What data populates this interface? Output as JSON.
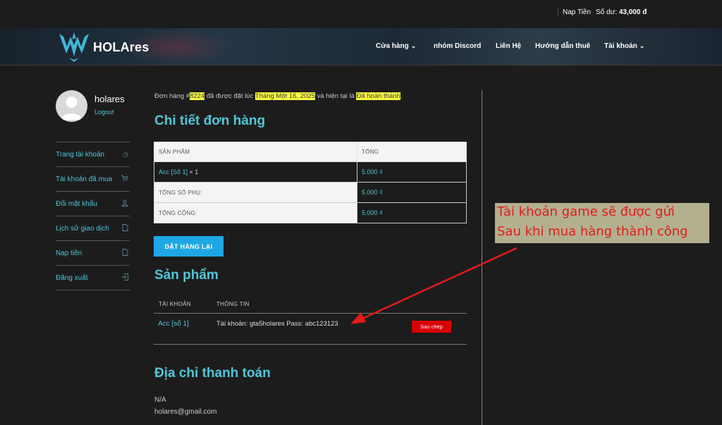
{
  "topbar": {
    "nap_tien": "Nap Tiền",
    "balance_label": "Số dư:",
    "balance_value": "43,000 đ"
  },
  "header": {
    "logo_text": "HOLAres",
    "nav": [
      {
        "label": "Cửa hàng",
        "has_dropdown": true
      },
      {
        "label": "nhóm Discord",
        "has_dropdown": false
      },
      {
        "label": "Liên Hệ",
        "has_dropdown": false
      },
      {
        "label": "Hướng dẫn thuê",
        "has_dropdown": false
      },
      {
        "label": "Tài khoản",
        "has_dropdown": true
      }
    ],
    "chevron": "⌄"
  },
  "sidebar": {
    "username": "holares",
    "logout": "Logout",
    "items": [
      {
        "label": "Trang tài khoản",
        "icon": "dashboard-icon",
        "glyph": "◷"
      },
      {
        "label": "Tài khoản đã mua",
        "icon": "cart-icon",
        "glyph": "🛒"
      },
      {
        "label": "Đổi mật khẩu",
        "icon": "user-icon",
        "glyph": "♙"
      },
      {
        "label": "Lịch sử giao dịch",
        "icon": "document-icon",
        "glyph": "▯"
      },
      {
        "label": "Nạp tiền",
        "icon": "document-icon",
        "glyph": "▯"
      },
      {
        "label": "Đăng xuất",
        "icon": "logout-icon",
        "glyph": "⇥"
      }
    ]
  },
  "order": {
    "prefix": "Đơn hàng #",
    "number": "8224",
    "mid1": " đã được đặt lúc ",
    "date": "Tháng Một 16, 2025",
    "mid2": " và hiện tại là ",
    "status": "Đã hoàn thành",
    "end": "."
  },
  "details": {
    "title": "Chi tiết đơn hàng",
    "col_product": "SẢN PHẨM",
    "col_total": "TỔNG",
    "product_name": "Acc [Số 1]",
    "product_qty": " × 1",
    "product_total": "5.000 ₫",
    "subtotal_label": "TỔNG SỐ PHỤ:",
    "subtotal_value": "5.000 ₫",
    "total_label": "TỔNG CỘNG:",
    "total_value": "5.000 ₫",
    "reorder_button": "ĐẶT HÀNG LẠI"
  },
  "products": {
    "title": "Sản phẩm",
    "col_account": "TÀI KHOẢN",
    "col_info": "THÔNG TIN",
    "account": "Acc [số 1]",
    "info": "Tài khoản: gta5holares Pass: abc123123",
    "copy_button": "Sao chép"
  },
  "billing": {
    "title": "Địa chỉ thanh toán",
    "name": "N/A",
    "email": "holares@gmail.com"
  },
  "annotation": {
    "line1": "Tài khoản game sẽ được gửi",
    "line2": "Sau khi mua hàng thành công",
    "color": "#e21b1b"
  }
}
